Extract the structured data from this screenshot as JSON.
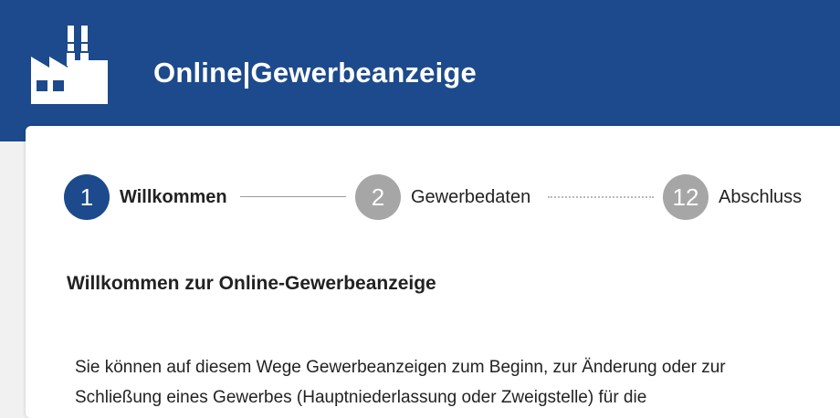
{
  "header": {
    "logo_icon": "factory-icon",
    "title": "Online|Gewerbeanzeige",
    "background_color": "#1c4a8c"
  },
  "stepper": {
    "steps": [
      {
        "number": "1",
        "label": "Willkommen",
        "state": "active"
      },
      {
        "number": "2",
        "label": "Gewerbedaten",
        "state": "inactive"
      },
      {
        "number": "12",
        "label": "Abschluss",
        "state": "inactive"
      }
    ],
    "active_color": "#1c4a8c",
    "inactive_color": "#a6a6a6"
  },
  "main": {
    "heading": "Willkommen zur Online-Gewerbeanzeige",
    "intro_line1": "Sie können auf diesem Wege Gewerbeanzeigen zum Beginn, zur Änderung oder zur",
    "intro_line2": "Schließung eines Gewerbes (Hauptniederlassung oder Zweigstelle) für die"
  }
}
